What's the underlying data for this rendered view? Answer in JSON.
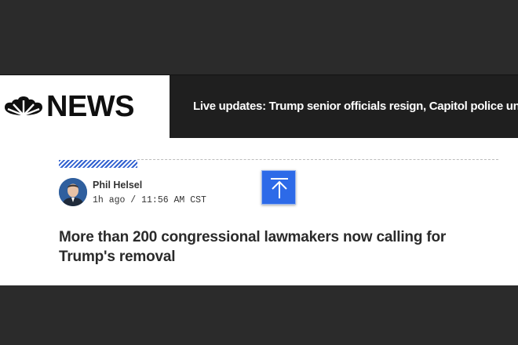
{
  "header": {
    "logo_text": "NEWS",
    "ticker_text": "Live updates: Trump senior officials resign, Capitol police under scrutiny"
  },
  "post": {
    "author": "Phil Helsel",
    "timestamp": "1h ago / 11:56 AM CST",
    "headline": "More than 200 congressional lawmakers now calling for Trump's removal"
  },
  "colors": {
    "accent": "#2d6ae8",
    "header_bg": "#1f1f1f"
  }
}
